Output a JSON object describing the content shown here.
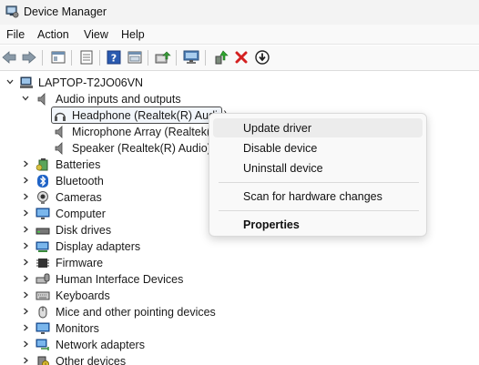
{
  "window": {
    "title": "Device Manager"
  },
  "menu": [
    "File",
    "Action",
    "View",
    "Help"
  ],
  "toolbar": {
    "buttons": [
      "back-icon",
      "forward-icon",
      "properties-pane-icon",
      "list-view-icon",
      "help-icon",
      "view-toggle-icon",
      "update-driver-icon",
      "scan-hardware-icon",
      "enable-device-icon",
      "uninstall-icon",
      "disable-device-icon"
    ]
  },
  "tree": {
    "root": "LAPTOP-T2JO06VN",
    "audio_category": "Audio inputs and outputs",
    "audio_children": [
      "Headphone (Realtek(R) Audio)",
      "Microphone Array (Realtek(R",
      "Speaker (Realtek(R) Audio)"
    ],
    "categories": [
      "Batteries",
      "Bluetooth",
      "Cameras",
      "Computer",
      "Disk drives",
      "Display adapters",
      "Firmware",
      "Human Interface Devices",
      "Keyboards",
      "Mice and other pointing devices",
      "Monitors",
      "Network adapters",
      "Other devices"
    ]
  },
  "context_menu": {
    "update_driver": "Update driver",
    "disable_device": "Disable device",
    "uninstall_device": "Uninstall device",
    "scan_changes": "Scan for hardware changes",
    "properties": "Properties"
  }
}
